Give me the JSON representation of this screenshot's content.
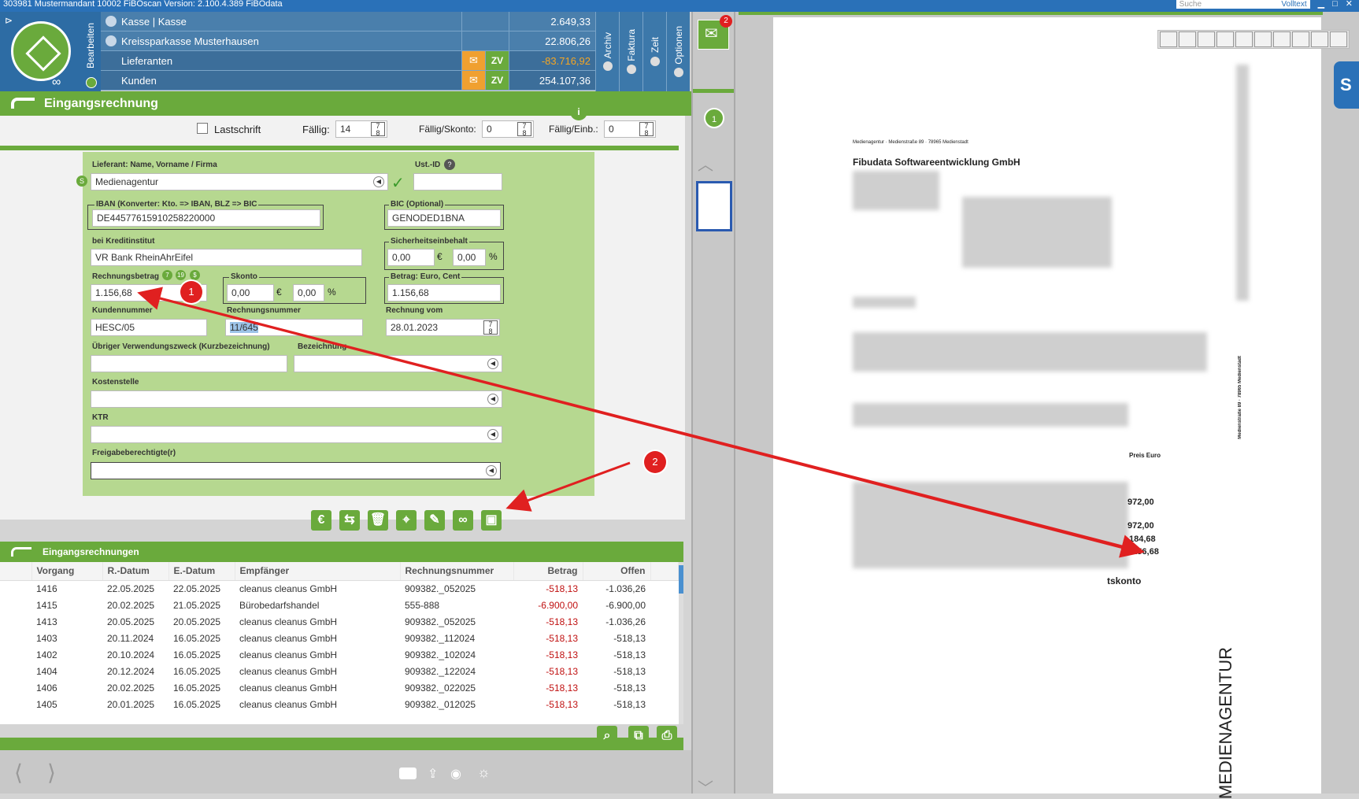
{
  "window": {
    "title": "303981 Mustermandant 10002 FiBOscan Version: 2.100.4.389 FiBOdata",
    "search_placeholder": "Suche",
    "search_mode": "Volltext"
  },
  "left_toolbar": {
    "bearbeiten": "Bearbeiten"
  },
  "accounts": [
    {
      "label": "Kasse | Kasse",
      "amount": "2.649,33"
    },
    {
      "label": "Kreissparkasse Musterhausen",
      "amount": "22.806,26"
    },
    {
      "label": "Lieferanten",
      "amount": "-83.716,92",
      "zv": "ZV",
      "amount_color": "#f5a623"
    },
    {
      "label": "Kunden",
      "amount": "254.107,36",
      "zv": "ZV"
    }
  ],
  "vtabs": {
    "archiv": "Archiv",
    "faktura": "Faktura",
    "zeit": "Zeit",
    "optionen": "Optionen"
  },
  "mail_badge": "2",
  "form": {
    "title": "Eingangsrechnung",
    "lastschrift": "Lastschrift",
    "faellig_label": "Fällig:",
    "faellig_value": "14",
    "faellig_skonto_label": "Fällig/Skonto:",
    "faellig_skonto_value": "0",
    "faellig_einb_label": "Fällig/Einb.:",
    "faellig_einb_value": "0",
    "lieferant_label": "Lieferant: Name, Vorname / Firma",
    "lieferant_value": "Medienagentur",
    "ustid_label": "Ust.-ID",
    "iban_label": "IBAN (Konverter: Kto. => IBAN, BLZ => BIC",
    "iban_value": "DE44577615910258220000",
    "bic_label": "BIC (Optional)",
    "bic_value": "GENODED1BNA",
    "kreditinstitut_label": "bei Kreditinstitut",
    "kreditinstitut_value": "VR Bank RheinAhrEifel",
    "sicherheit_label": "Sicherheitseinbehalt",
    "sicherheit_eur": "0,00",
    "sicherheit_pct": "0,00",
    "rechnungsbetrag_label": "Rechnungsbetrag",
    "rechnungsbetrag_value": "1.156,68",
    "skonto_label": "Skonto",
    "skonto_eur": "0,00",
    "skonto_pct": "0,00",
    "betrag_label": "Betrag: Euro, Cent",
    "betrag_value": "1.156,68",
    "kundennummer_label": "Kundennummer",
    "kundennummer_value": "HESC/05",
    "rechnungsnummer_label": "Rechnungsnummer",
    "rechnungsnummer_value": "11/645",
    "rechnungvom_label": "Rechnung vom",
    "rechnungvom_value": "28.01.2023",
    "verwendung_label": "Übriger Verwendungszweck (Kurzbezeichnung)",
    "bezeichnung_label": "Bezeichnung",
    "kostenstelle_label": "Kostenstelle",
    "ktr_label": "KTR",
    "freigabe_label": "Freigabeberechtigte(r)",
    "euro": "€",
    "pct": "%"
  },
  "annotations": {
    "badge1": "1",
    "badge2": "2"
  },
  "list": {
    "title": "Eingangsrechnungen",
    "columns": [
      "Vorgang",
      "R.-Datum",
      "E.-Datum",
      "Empfänger",
      "Rechnungsnummer",
      "Betrag",
      "Offen"
    ],
    "rows": [
      [
        "1416",
        "22.05.2025",
        "22.05.2025",
        "cleanus cleanus GmbH",
        "909382._052025",
        "-518,13",
        "-1.036,26"
      ],
      [
        "1415",
        "20.02.2025",
        "21.05.2025",
        "Bürobedarfshandel",
        "555-888",
        "-6.900,00",
        "-6.900,00"
      ],
      [
        "1413",
        "20.05.2025",
        "20.05.2025",
        "cleanus cleanus GmbH",
        "909382._052025",
        "-518,13",
        "-1.036,26"
      ],
      [
        "1403",
        "20.11.2024",
        "16.05.2025",
        "cleanus cleanus GmbH",
        "909382._112024",
        "-518,13",
        "-518,13"
      ],
      [
        "1402",
        "20.10.2024",
        "16.05.2025",
        "cleanus cleanus GmbH",
        "909382._102024",
        "-518,13",
        "-518,13"
      ],
      [
        "1404",
        "20.12.2024",
        "16.05.2025",
        "cleanus cleanus GmbH",
        "909382._122024",
        "-518,13",
        "-518,13"
      ],
      [
        "1406",
        "20.02.2025",
        "16.05.2025",
        "cleanus cleanus GmbH",
        "909382._022025",
        "-518,13",
        "-518,13"
      ],
      [
        "1405",
        "20.01.2025",
        "16.05.2025",
        "cleanus cleanus GmbH",
        "909382._012025",
        "-518,13",
        "-518,13"
      ]
    ]
  },
  "page_indicator": "1",
  "document": {
    "sender_line": "Medienagentur · Medienstraße 89 · 78965 Medienstadt",
    "recipient": "Fibudata Softwareentwicklung GmbH",
    "col_header": "Preis Euro",
    "v1": "972,00",
    "v2": "972,00",
    "v3": "184,68",
    "total": "1.156,68",
    "skonto_text": "tskonto",
    "vertical_brand": "MEDIENAGENTUR",
    "side_address": "Medienstraße 89 · 78965 Medienstadt"
  }
}
